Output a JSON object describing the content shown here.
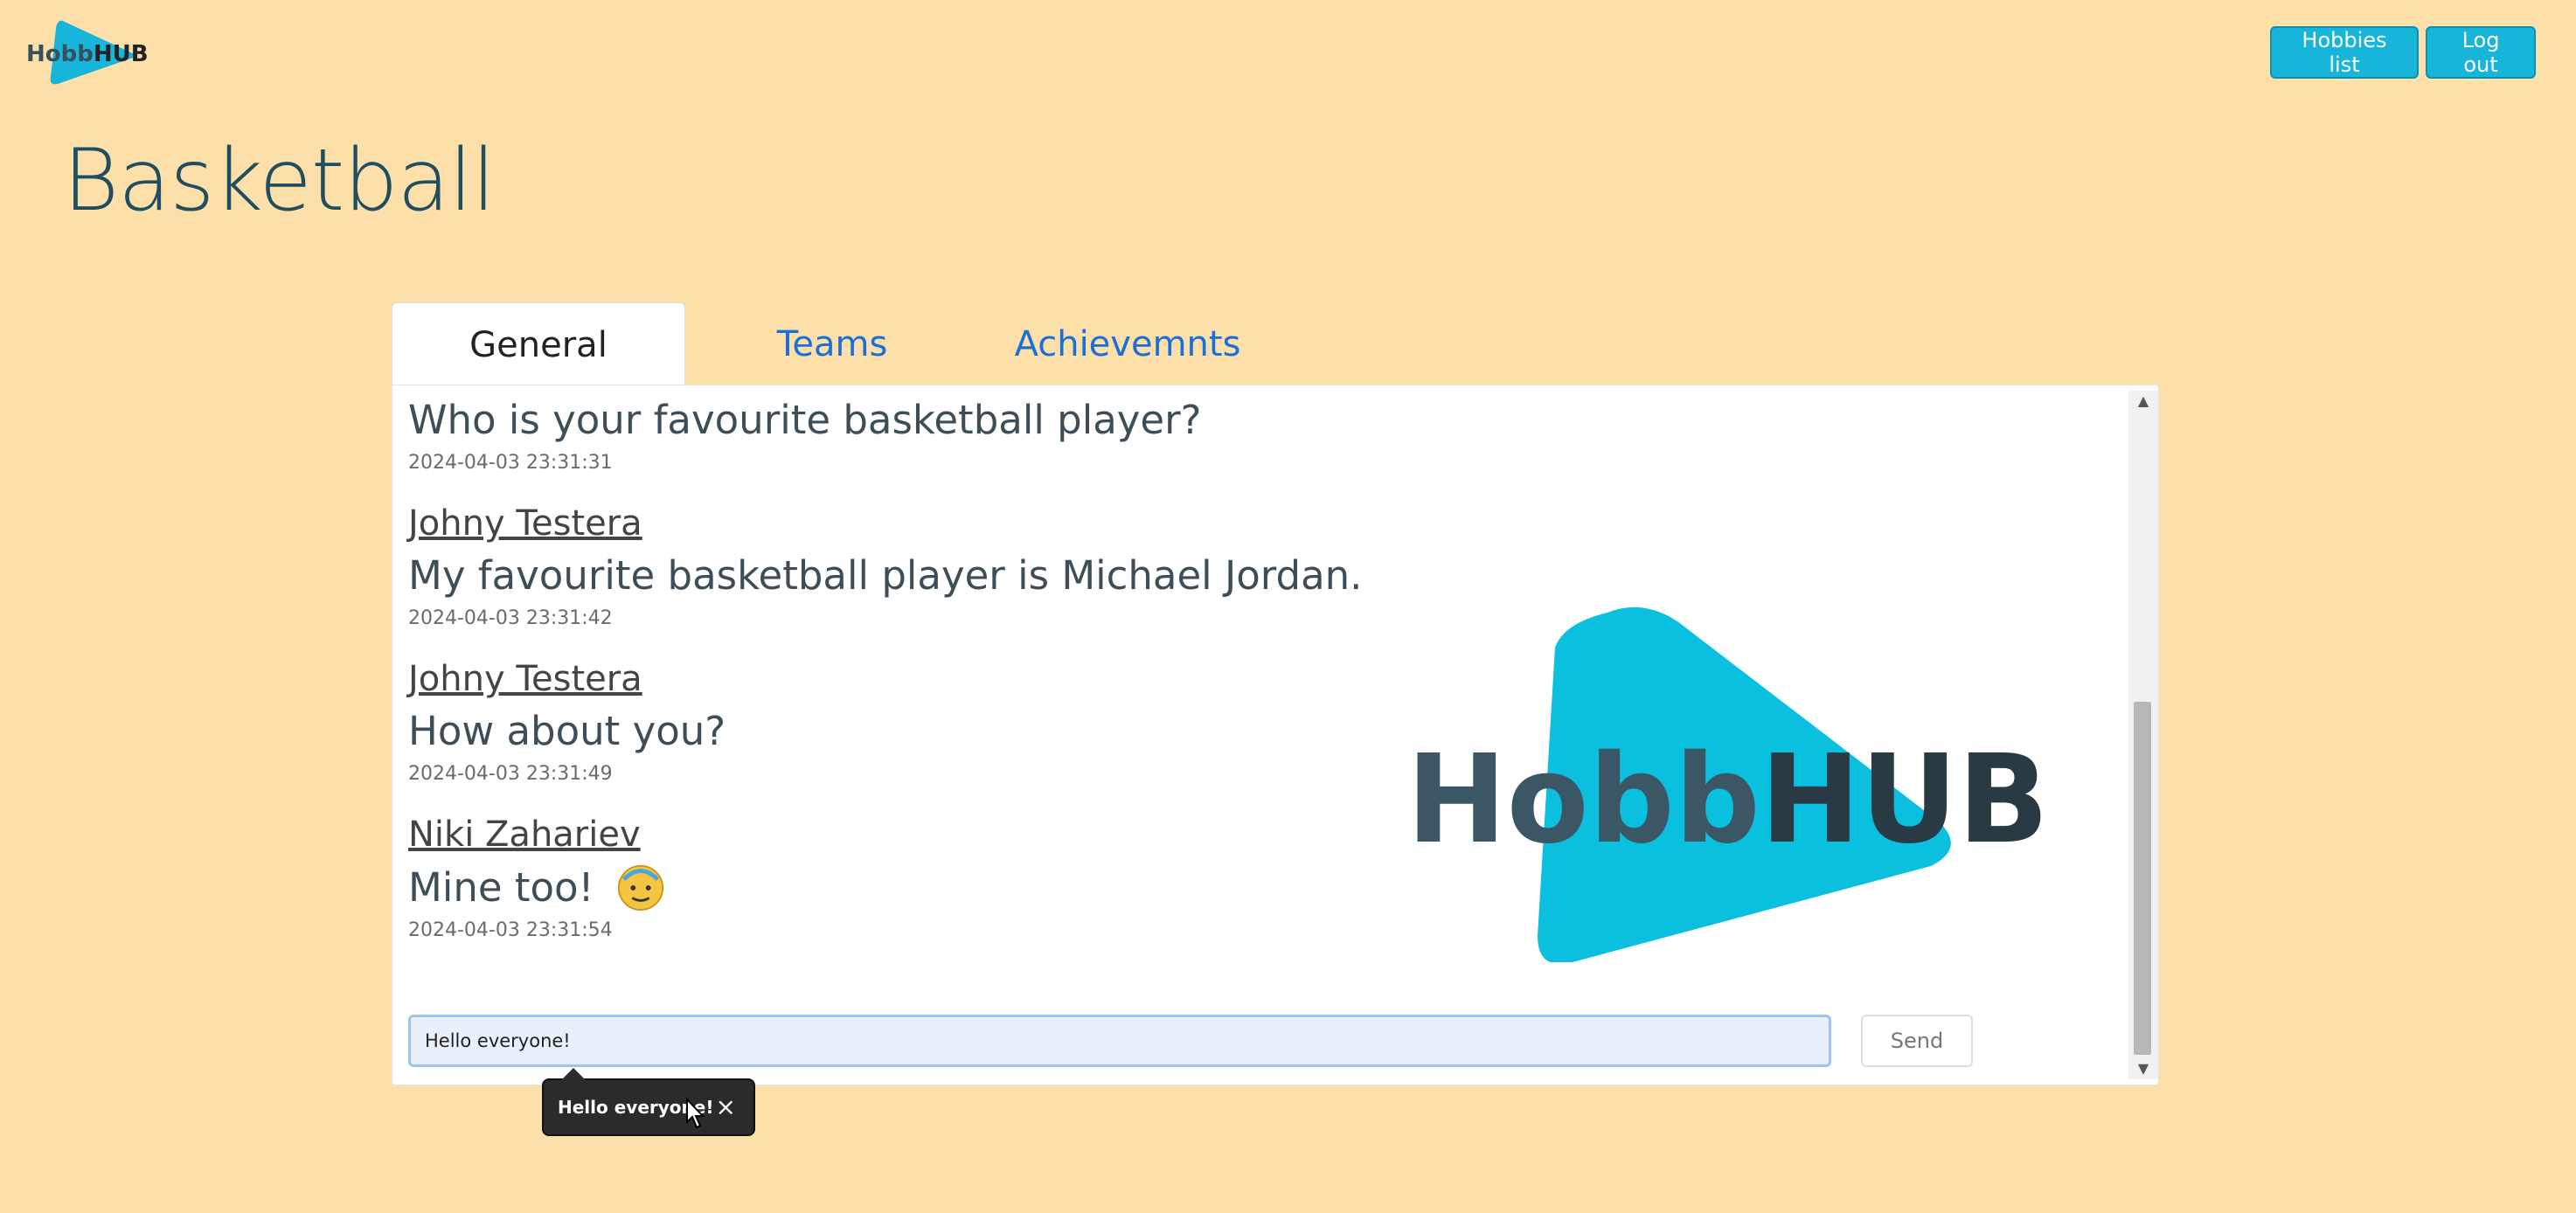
{
  "header": {
    "logo_text": "HobbHUB",
    "hobbies_button": "Hobbies list",
    "logout_button": "Log out"
  },
  "page_title": "Basketball",
  "tabs": [
    {
      "label": "General",
      "active": true
    },
    {
      "label": "Teams",
      "active": false
    },
    {
      "label": "Achievemnts",
      "active": false
    }
  ],
  "messages": [
    {
      "author": "",
      "text": "Who is your favourite basketball player?",
      "time": "2024-04-03 23:31:31"
    },
    {
      "author": "Johny Testera",
      "text": "My favourite basketball player is Michael Jordan.",
      "time": "2024-04-03 23:31:42"
    },
    {
      "author": "Johny Testera",
      "text": "How about you?",
      "time": "2024-04-03 23:31:49"
    },
    {
      "author": "Niki Zahariev",
      "text": "Mine too! ",
      "time": "2024-04-03 23:31:54"
    }
  ],
  "input": {
    "value": "Hello everyone!",
    "send_label": "Send"
  },
  "autofill": {
    "text": "Hello everyone!",
    "close": "×"
  },
  "colors": {
    "background": "#fddfa9",
    "accent": "#17b5d9",
    "title": "#1f4e60",
    "link": "#1a6fd8"
  }
}
